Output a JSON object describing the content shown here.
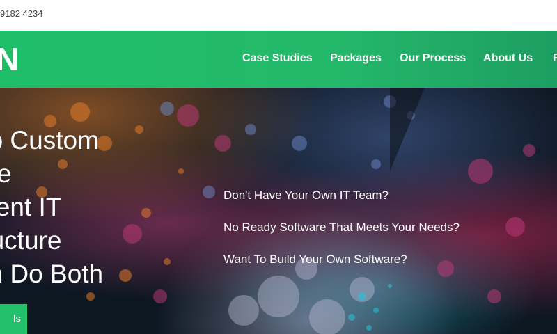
{
  "topbar": {
    "phone": "9182 4234"
  },
  "nav": {
    "logo": "N",
    "items": [
      "Case Studies",
      "Packages",
      "Our Process",
      "About Us",
      "F"
    ]
  },
  "hero": {
    "headline": [
      "op Custom",
      "are",
      "ment IT",
      "tructure",
      "an Do Both"
    ],
    "questions": [
      "Don't Have Your Own IT Team?",
      "No Ready Software That Meets Your Needs?",
      "Want To Build Your Own Software?"
    ],
    "cta": "ls"
  },
  "colors": {
    "brand_green": "#22c06b",
    "hero_bg": "#0d1722"
  }
}
